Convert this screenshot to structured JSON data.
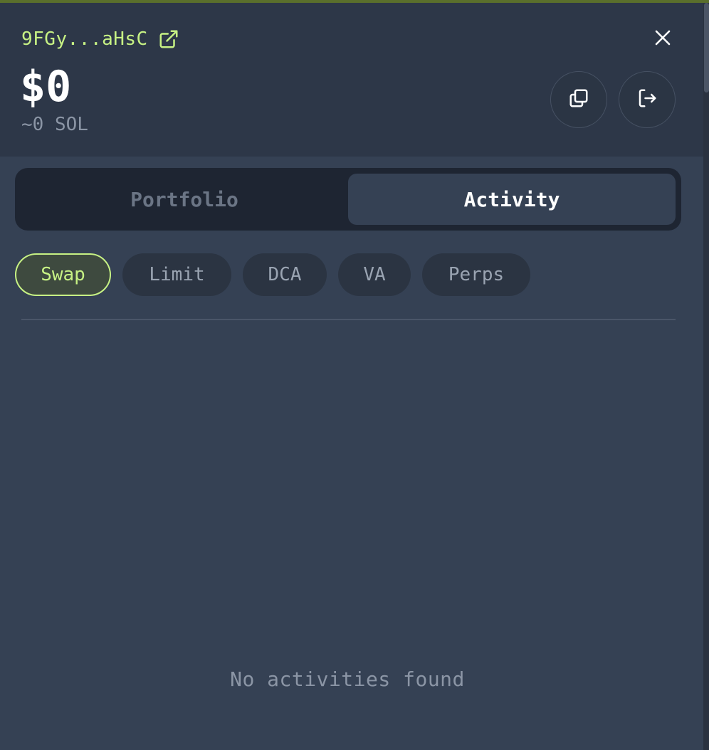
{
  "header": {
    "wallet_address": "9FGy...aHsC",
    "balance_usd": "$0",
    "balance_sol": "~0 SOL"
  },
  "icons": {
    "external_link": "external-link-icon",
    "close": "close-icon",
    "copy": "copy-icon",
    "logout": "logout-icon"
  },
  "tabs": [
    {
      "label": "Portfolio",
      "active": false
    },
    {
      "label": "Activity",
      "active": true
    }
  ],
  "filters": [
    {
      "label": "Swap",
      "active": true
    },
    {
      "label": "Limit",
      "active": false
    },
    {
      "label": "DCA",
      "active": false
    },
    {
      "label": "VA",
      "active": false
    },
    {
      "label": "Perps",
      "active": false
    }
  ],
  "empty_state": "No activities found",
  "colors": {
    "accent": "#c7f284",
    "panel_bg": "#354154",
    "header_bg": "#2d3748",
    "tabbar_bg": "#1e2532"
  }
}
